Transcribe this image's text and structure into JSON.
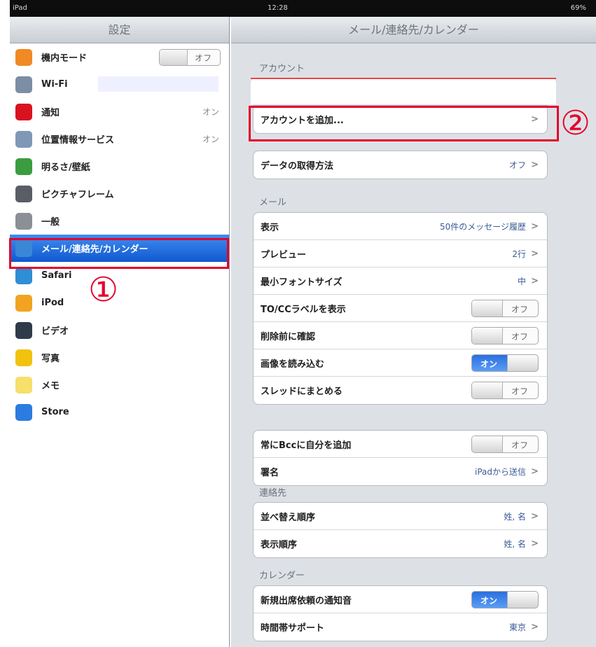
{
  "status": {
    "carrier": "iPad",
    "time": "12:28",
    "battery": "69%"
  },
  "left": {
    "title": "設定",
    "items": [
      {
        "label": "機内モード",
        "icon": "airplane-icon",
        "color": "#f08a24",
        "switch": "オフ"
      },
      {
        "label": "Wi-Fi",
        "icon": "wifi-icon",
        "color": "#7c8ea3"
      },
      {
        "label": "通知",
        "icon": "notification-icon",
        "color": "#d9121f",
        "value": "オン"
      },
      {
        "label": "位置情報サービス",
        "icon": "location-icon",
        "color": "#7f98b7",
        "value": "オン"
      },
      {
        "label": "明るさ/壁紙",
        "icon": "brightness-icon",
        "color": "#3b9d3f"
      },
      {
        "label": "ピクチャフレーム",
        "icon": "picture-frame-icon",
        "color": "#5a5e64"
      },
      {
        "label": "一般",
        "icon": "gear-icon",
        "color": "#8b8f96"
      },
      {
        "label": "メール/連絡先/カレンダー",
        "icon": "mail-icon",
        "color": "#3a87d8"
      },
      {
        "label": "Safari",
        "icon": "safari-icon",
        "color": "#2e8ed6"
      },
      {
        "label": "iPod",
        "icon": "ipod-icon",
        "color": "#f2a321"
      },
      {
        "label": "ビデオ",
        "icon": "video-icon",
        "color": "#2f3b49"
      },
      {
        "label": "写真",
        "icon": "photos-icon",
        "color": "#f1c30f"
      },
      {
        "label": "メモ",
        "icon": "notes-icon",
        "color": "#f6df6b"
      },
      {
        "label": "Store",
        "icon": "store-icon",
        "color": "#2b7be0"
      }
    ],
    "selected_index": 7
  },
  "right": {
    "title": "メール/連絡先/カレンダー",
    "accounts": {
      "label": "アカウント",
      "account_text": "",
      "add_label": "アカウントを追加..."
    },
    "fetch": {
      "label": "データの取得方法",
      "value": "オフ"
    },
    "mail": {
      "label": "メール",
      "rows": [
        {
          "label": "表示",
          "value": "50件のメッセージ履歴"
        },
        {
          "label": "プレビュー",
          "value": "2行"
        },
        {
          "label": "最小フォントサイズ",
          "value": "中"
        },
        {
          "label": "TO/CCラベルを表示",
          "switch": "オフ"
        },
        {
          "label": "削除前に確認",
          "switch": "オフ"
        },
        {
          "label": "画像を読み込む",
          "switch": "オン"
        },
        {
          "label": "スレッドにまとめる",
          "switch": "オフ"
        }
      ],
      "rows2": [
        {
          "label": "常にBccに自分を追加",
          "switch": "オフ"
        },
        {
          "label": "署名",
          "value": "iPadから送信"
        }
      ]
    },
    "contacts": {
      "label": "連絡先",
      "rows": [
        {
          "label": "並べ替え順序",
          "value": "姓, 名"
        },
        {
          "label": "表示順序",
          "value": "姓, 名"
        }
      ]
    },
    "calendar": {
      "label": "カレンダー",
      "rows": [
        {
          "label": "新規出席依頼の通知音",
          "switch": "オン"
        },
        {
          "label": "時間帯サポート",
          "value": "東京"
        }
      ]
    }
  },
  "annotations": {
    "one": "①",
    "two": "②"
  }
}
